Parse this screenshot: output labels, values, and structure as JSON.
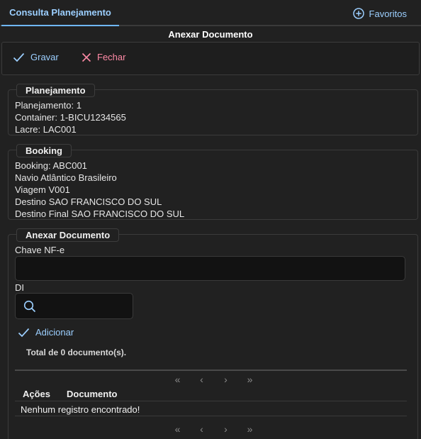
{
  "tabs": {
    "active_label": "Consulta Planejamento"
  },
  "favorites": {
    "label": "Favoritos"
  },
  "page": {
    "title": "Anexar Documento"
  },
  "toolbar": {
    "save_label": "Gravar",
    "close_label": "Fechar"
  },
  "planejamento": {
    "legend": "Planejamento",
    "lines": [
      "Planejamento: 1",
      "Container: 1-BICU1234565",
      "Lacre: LAC001"
    ]
  },
  "booking": {
    "legend": "Booking",
    "lines": [
      "Booking: ABC001",
      "Navio Atlântico Brasileiro",
      "Viagem V001",
      "Destino SAO FRANCISCO DO SUL",
      "Destino Final SAO FRANCISCO DO SUL"
    ]
  },
  "anexar": {
    "legend": "Anexar Documento",
    "chave_label": "Chave NF-e",
    "chave_value": "",
    "di_label": "DI",
    "di_value": "",
    "add_label": "Adicionar",
    "total": "Total de 0 documento(s).",
    "columns": [
      "Ações",
      "Documento"
    ],
    "empty_message": "Nenhum registro encontrado!",
    "pager": [
      "«",
      "‹",
      "›",
      "»"
    ]
  },
  "colors": {
    "accent": "#9ccfff",
    "danger": "#ff8aa6",
    "background": "#212121"
  }
}
